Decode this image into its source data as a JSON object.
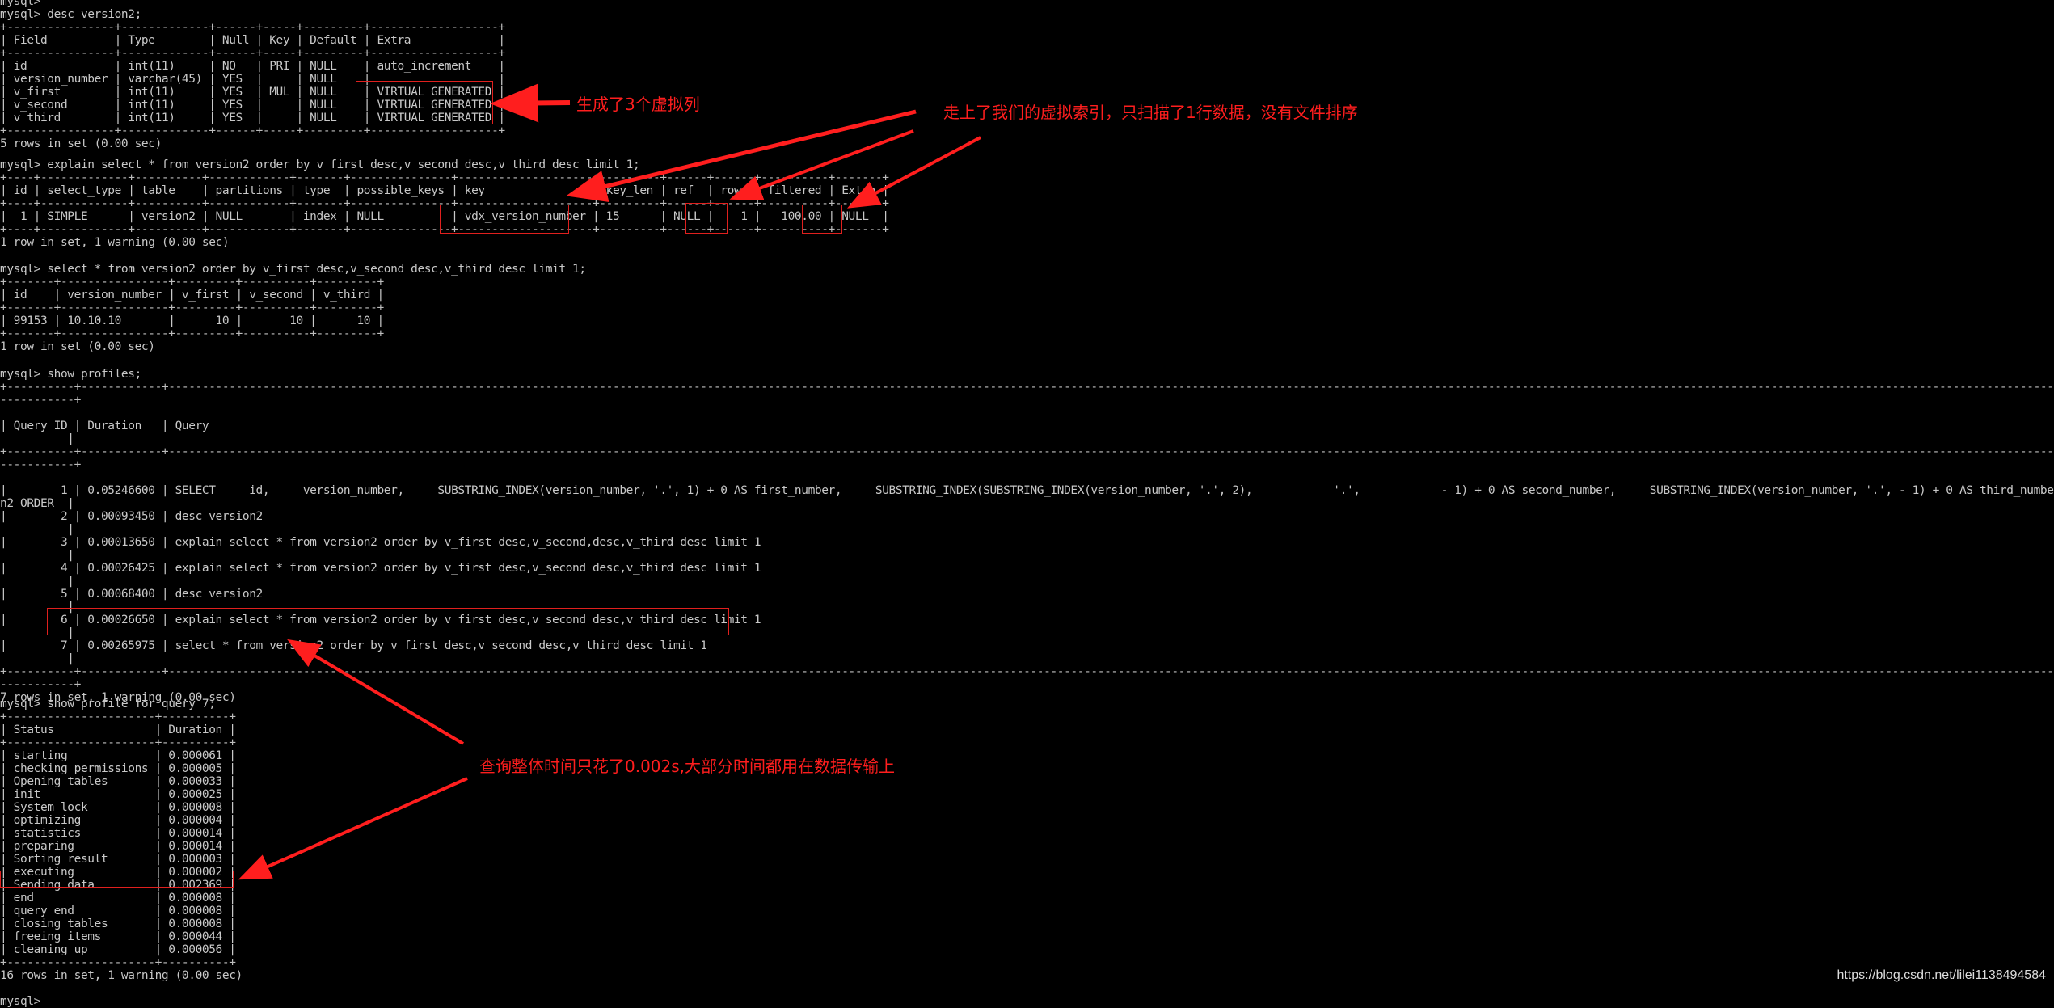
{
  "terminal": {
    "prompt": "mysql>",
    "desc": {
      "command": "desc version2;",
      "columns": [
        "Field",
        "Type",
        "Null",
        "Key",
        "Default",
        "Extra"
      ],
      "rows": [
        [
          "id",
          "int(11)",
          "NO",
          "PRI",
          "NULL",
          "auto_increment"
        ],
        [
          "version_number",
          "varchar(45)",
          "YES",
          "",
          "NULL",
          ""
        ],
        [
          "v_first",
          "int(11)",
          "YES",
          "MUL",
          "NULL",
          "VIRTUAL GENERATED"
        ],
        [
          "v_second",
          "int(11)",
          "YES",
          "",
          "NULL",
          "VIRTUAL GENERATED"
        ],
        [
          "v_third",
          "int(11)",
          "YES",
          "",
          "NULL",
          "VIRTUAL GENERATED"
        ]
      ],
      "footer": "5 rows in set (0.00 sec)"
    },
    "explain": {
      "command": "explain select * from version2 order by v_first desc,v_second desc,v_third desc limit 1;",
      "columns": [
        "id",
        "select_type",
        "table",
        "partitions",
        "type",
        "possible_keys",
        "key",
        "key_len",
        "ref",
        "rows",
        "filtered",
        "Extra"
      ],
      "rows": [
        [
          "1",
          "SIMPLE",
          "version2",
          "NULL",
          "index",
          "NULL",
          "vdx_version_number",
          "15",
          "NULL",
          "1",
          "100.00",
          "NULL"
        ]
      ],
      "footer": "1 row in set, 1 warning (0.00 sec)"
    },
    "select": {
      "command": "select * from version2 order by v_first desc,v_second desc,v_third desc limit 1;",
      "columns": [
        "id",
        "version_number",
        "v_first",
        "v_second",
        "v_third"
      ],
      "rows": [
        [
          "99153",
          "10.10.10",
          "10",
          "10",
          "10"
        ]
      ],
      "footer": "1 row in set (0.00 sec)"
    },
    "profiles": {
      "command": "show profiles;",
      "columns": [
        "Query_ID",
        "Duration",
        "Query"
      ],
      "rows": [
        {
          "id": "1",
          "duration": "0.05246600",
          "query": "SELECT     id,     version_number,     SUBSTRING_INDEX(version_number, '.', 1) + 0 AS first_number,     SUBSTRING_INDEX(SUBSTRING_INDEX(version_number, '.', 2),            '.',            - 1) + 0 AS second_number,     SUBSTRING_INDEX(version_number, '.', - 1) + 0 AS third_number FROM     versio",
          "wrap": "n2 ORDER"
        },
        {
          "id": "2",
          "duration": "0.00093450",
          "query": "desc version2"
        },
        {
          "id": "3",
          "duration": "0.00013650",
          "query": "explain select * from version2 order by v_first desc,v_second,desc,v_third desc limit 1"
        },
        {
          "id": "4",
          "duration": "0.00026425",
          "query": "explain select * from version2 order by v_first desc,v_second desc,v_third desc limit 1"
        },
        {
          "id": "5",
          "duration": "0.00068400",
          "query": "desc version2"
        },
        {
          "id": "6",
          "duration": "0.00026650",
          "query": "explain select * from version2 order by v_first desc,v_second desc,v_third desc limit 1"
        },
        {
          "id": "7",
          "duration": "0.00265975",
          "query": "select * from version2 order by v_first desc,v_second desc,v_third desc limit 1"
        }
      ],
      "footer": "7 rows in set, 1 warning (0.00 sec)"
    },
    "profile": {
      "command": "show profile for query 7;",
      "columns": [
        "Status",
        "Duration"
      ],
      "rows": [
        [
          "starting",
          "0.000061"
        ],
        [
          "checking permissions",
          "0.000005"
        ],
        [
          "Opening tables",
          "0.000033"
        ],
        [
          "init",
          "0.000025"
        ],
        [
          "System lock",
          "0.000008"
        ],
        [
          "optimizing",
          "0.000004"
        ],
        [
          "statistics",
          "0.000014"
        ],
        [
          "preparing",
          "0.000014"
        ],
        [
          "Sorting result",
          "0.000003"
        ],
        [
          "executing",
          "0.000002"
        ],
        [
          "Sending data",
          "0.002369"
        ],
        [
          "end",
          "0.000008"
        ],
        [
          "query end",
          "0.000008"
        ],
        [
          "closing tables",
          "0.000008"
        ],
        [
          "freeing items",
          "0.000044"
        ],
        [
          "cleaning up",
          "0.000056"
        ]
      ],
      "footer": "16 rows in set, 1 warning (0.00 sec)"
    }
  },
  "annotations": {
    "virtual_columns": "生成了3个虚拟列",
    "virtual_index": "走上了我们的虚拟索引，只扫描了1行数据，没有文件排序",
    "timing": "查询整体时间只花了0.002s,大部分时间都用在数据传输上"
  },
  "watermark": "https://blog.csdn.net/lilei1138494584",
  "colors": {
    "background": "#000000",
    "text": "#c8c8c8",
    "annotation": "#ff1e1e"
  }
}
